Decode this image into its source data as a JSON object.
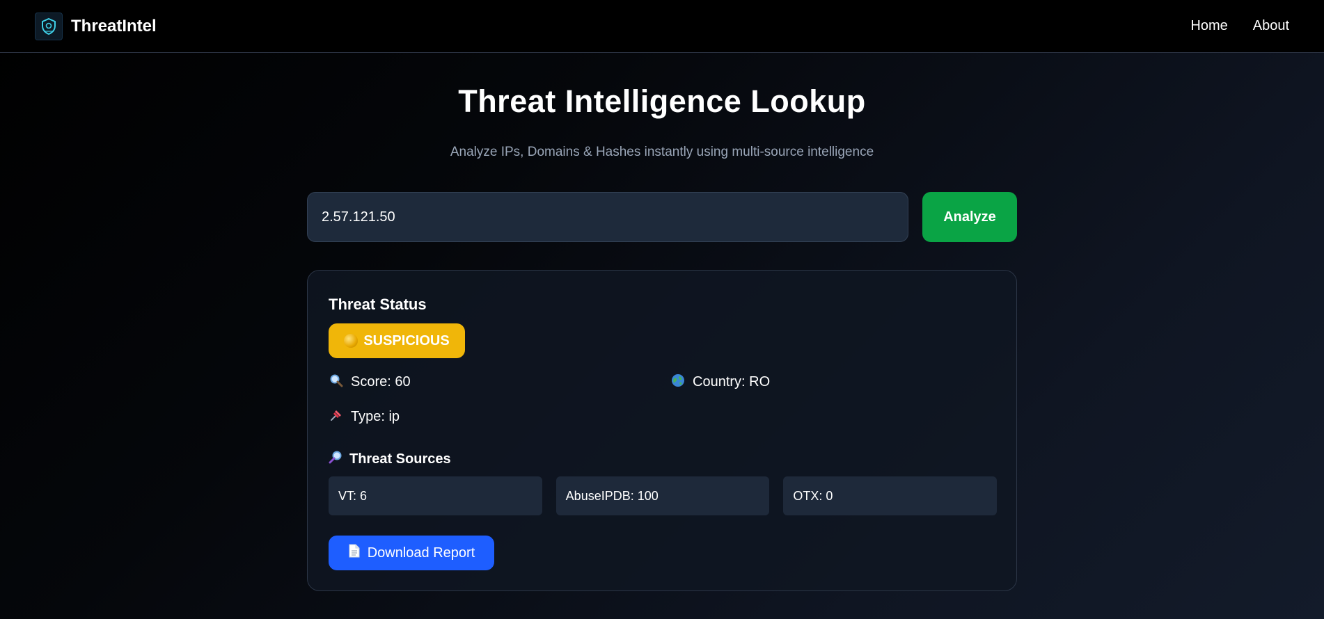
{
  "nav": {
    "brand": "ThreatIntel",
    "links": [
      "Home",
      "About"
    ]
  },
  "hero": {
    "title": "Threat Intelligence Lookup",
    "subtitle": "Analyze IPs, Domains & Hashes instantly using multi-source intelligence"
  },
  "search": {
    "value": "2.57.121.50",
    "button_label": "Analyze"
  },
  "result": {
    "heading": "Threat Status",
    "status": "SUSPICIOUS",
    "status_color": "#f0b609",
    "score": "Score: 60",
    "country": "Country: RO",
    "type": "Type: ip",
    "sources_heading": "Threat Sources",
    "sources": [
      "VT: 6",
      "AbuseIPDB: 100",
      "OTX: 0"
    ],
    "download_label": "Download Report"
  },
  "icons": {
    "score": "magnifier-icon",
    "country": "globe-icon",
    "type": "pushpin-icon",
    "sources": "magnifier-right-icon",
    "download": "document-icon",
    "status": "yellow-circle-icon"
  },
  "colors": {
    "analyze": "#0aa445",
    "download": "#1e5eff",
    "source_box": "#1e293a"
  }
}
